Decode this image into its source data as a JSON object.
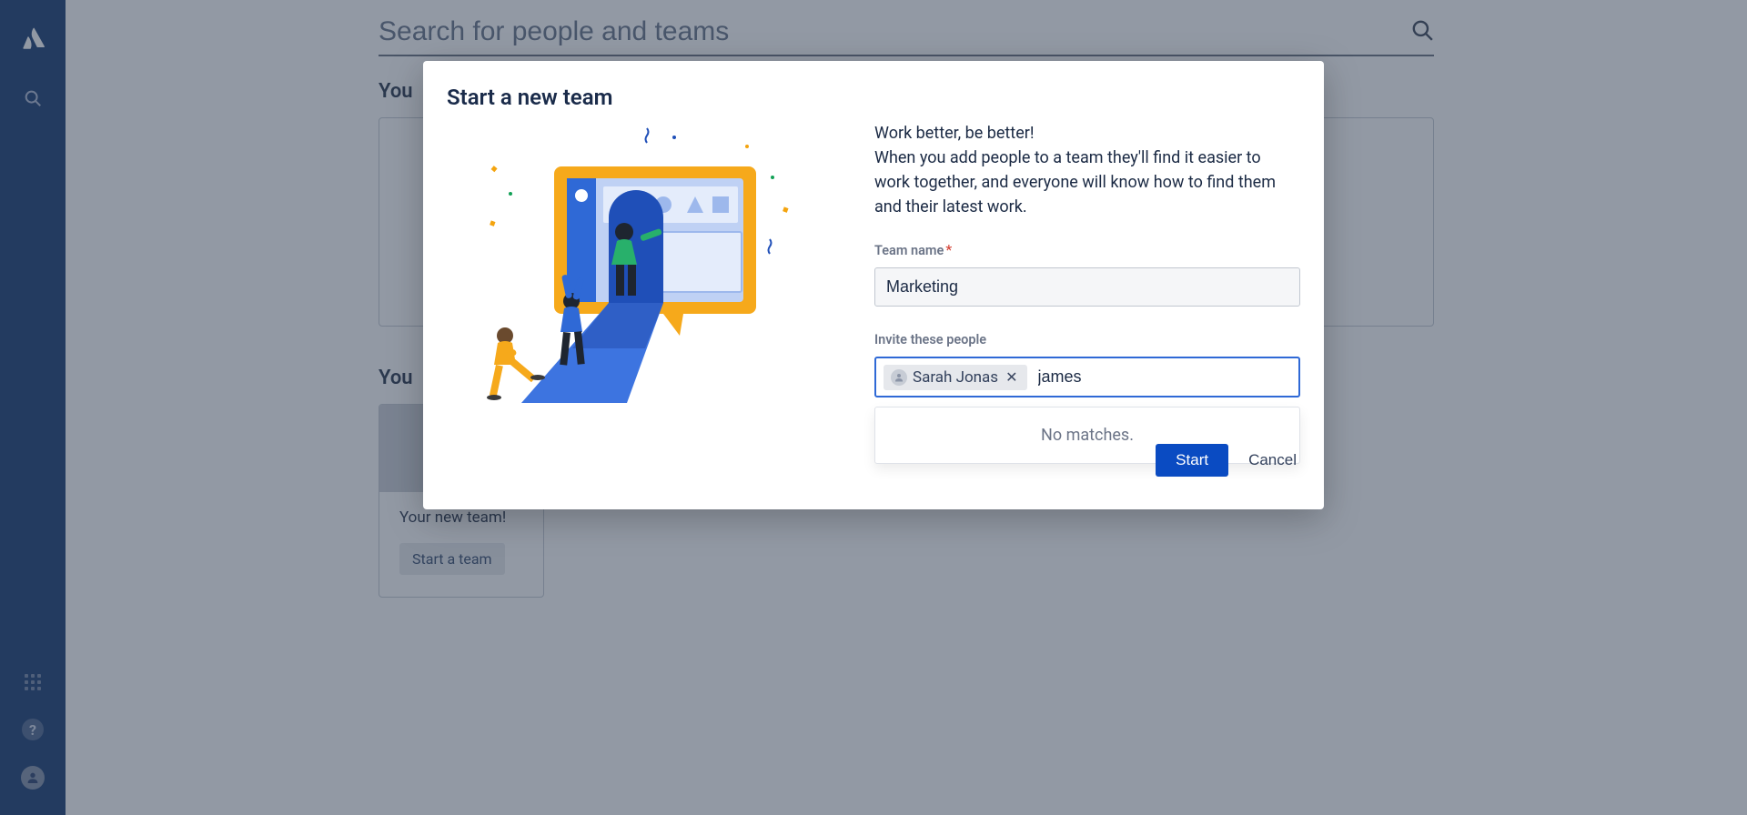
{
  "search": {
    "placeholder": "Search for people and teams"
  },
  "sections": {
    "your1_label": "You",
    "your2_label": "You"
  },
  "team_card": {
    "title": "Your new team!",
    "cta": "Start a team"
  },
  "modal": {
    "title": "Start a new team",
    "copy_line1": "Work better, be better!",
    "copy_rest": "When you add people to a team they'll find it easier to work together, and everyone will know how to find them and their latest work.",
    "team_name_label": "Team name",
    "team_name_value": "Marketing",
    "invite_label": "Invite these people",
    "chip_name": "Sarah Jonas",
    "invite_input_value": "james",
    "dropdown_text": "No matches.",
    "start_btn": "Start",
    "cancel_btn": "Cancel"
  }
}
